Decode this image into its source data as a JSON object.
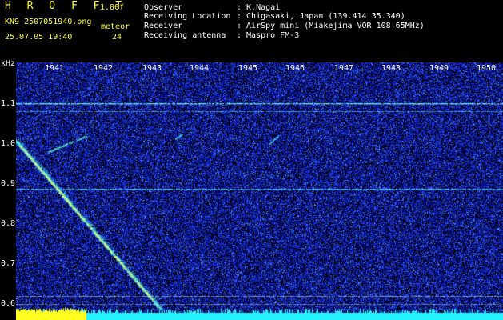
{
  "header": {
    "app_title": "H R O F F T",
    "version": "1.00f",
    "filename": "KN9_2507051940.png",
    "meteor_label": "meteor",
    "timestamp": "25.07.05 19:40",
    "meteor_count": "24"
  },
  "info": [
    {
      "key": "Observer",
      "value": ": K.Nagai"
    },
    {
      "key": "Receiving Location",
      "value": ": Chigasaki, Japan (139.414 35.340)"
    },
    {
      "key": "Receiver",
      "value": ": AirSpy mini (Miakejima VOR 108.65MHz)"
    },
    {
      "key": "Receiving antenna",
      "value": ": Maspro FM-3"
    }
  ],
  "axis": {
    "unit": "kHz",
    "y_ticks": [
      "1.1",
      "1.0",
      "0.9",
      "0.8",
      "0.7",
      "0.6"
    ],
    "x_ticks": [
      "1941",
      "1942",
      "1943",
      "1944",
      "1945",
      "1946",
      "1947",
      "1948",
      "1949",
      "1950"
    ]
  },
  "colors": {
    "background": "#000000",
    "header_yellow": "#ffff3c",
    "header_white": "#ffffff",
    "noise_blue": "#1c2cff",
    "line_cyan": "#5fe6ff",
    "bottom_cyan": "#25f2ff",
    "burst_yellow": "#ffff20"
  }
}
